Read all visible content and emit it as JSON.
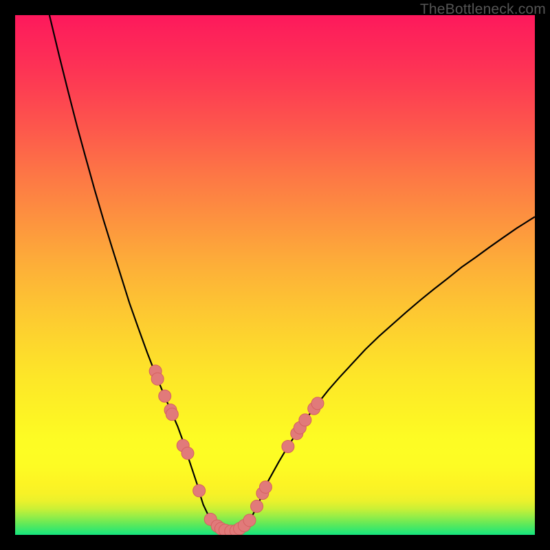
{
  "attribution": "TheBottleneck.com",
  "chart_data": {
    "type": "line",
    "title": "",
    "xlabel": "",
    "ylabel": "",
    "xlim": [
      0,
      100
    ],
    "ylim": [
      0,
      100
    ],
    "series": [
      {
        "name": "curve",
        "x": [
          6.6,
          8.5,
          10.2,
          11.9,
          13.6,
          15.3,
          17.0,
          18.7,
          20.4,
          22.0,
          23.7,
          25.4,
          27.1,
          28.8,
          29.7,
          31.3,
          32.5,
          33.2,
          33.9,
          35.0,
          35.6,
          36.2,
          37.3,
          38.6,
          41.3,
          44.0,
          45.8,
          47.0,
          48.6,
          50.7,
          52.6,
          54.5,
          56.4,
          58.4,
          60.3,
          62.4,
          64.9,
          67.4,
          70.0,
          72.7,
          75.3,
          78.0,
          80.6,
          83.3,
          85.9,
          88.6,
          91.2,
          93.9,
          96.5,
          99.2,
          100.0
        ],
        "values": [
          100.0,
          92.1,
          85.3,
          78.7,
          72.5,
          66.4,
          60.6,
          55.1,
          49.7,
          44.6,
          39.8,
          35.1,
          30.7,
          26.6,
          24.5,
          20.8,
          17.5,
          15.2,
          13.1,
          9.8,
          7.7,
          5.8,
          3.5,
          1.8,
          0.7,
          1.8,
          4.0,
          6.5,
          10.2,
          14.0,
          17.2,
          20.1,
          22.9,
          25.5,
          27.9,
          30.3,
          33.0,
          35.7,
          38.2,
          40.6,
          42.9,
          45.2,
          47.3,
          49.4,
          51.5,
          53.4,
          55.3,
          57.2,
          59.0,
          60.7,
          61.2
        ]
      }
    ],
    "markers": [
      {
        "x": 27.0,
        "y": 31.5
      },
      {
        "x": 27.4,
        "y": 30.0
      },
      {
        "x": 28.8,
        "y": 26.7
      },
      {
        "x": 29.9,
        "y": 24.0
      },
      {
        "x": 30.2,
        "y": 23.2
      },
      {
        "x": 32.3,
        "y": 17.2
      },
      {
        "x": 33.2,
        "y": 15.7
      },
      {
        "x": 35.4,
        "y": 8.5
      },
      {
        "x": 37.6,
        "y": 3.0
      },
      {
        "x": 38.9,
        "y": 1.7
      },
      {
        "x": 39.6,
        "y": 1.2
      },
      {
        "x": 40.4,
        "y": 0.9
      },
      {
        "x": 41.5,
        "y": 0.7
      },
      {
        "x": 42.5,
        "y": 0.8
      },
      {
        "x": 43.2,
        "y": 1.2
      },
      {
        "x": 44.1,
        "y": 1.8
      },
      {
        "x": 45.1,
        "y": 2.8
      },
      {
        "x": 46.5,
        "y": 5.5
      },
      {
        "x": 47.6,
        "y": 8.0
      },
      {
        "x": 48.2,
        "y": 9.2
      },
      {
        "x": 52.5,
        "y": 17.0
      },
      {
        "x": 54.2,
        "y": 19.5
      },
      {
        "x": 54.8,
        "y": 20.6
      },
      {
        "x": 55.8,
        "y": 22.1
      },
      {
        "x": 57.5,
        "y": 24.3
      },
      {
        "x": 58.2,
        "y": 25.3
      }
    ]
  },
  "colors": {
    "curve": "#000000",
    "marker_fill": "#e17a7a",
    "marker_stroke": "#d46060"
  }
}
